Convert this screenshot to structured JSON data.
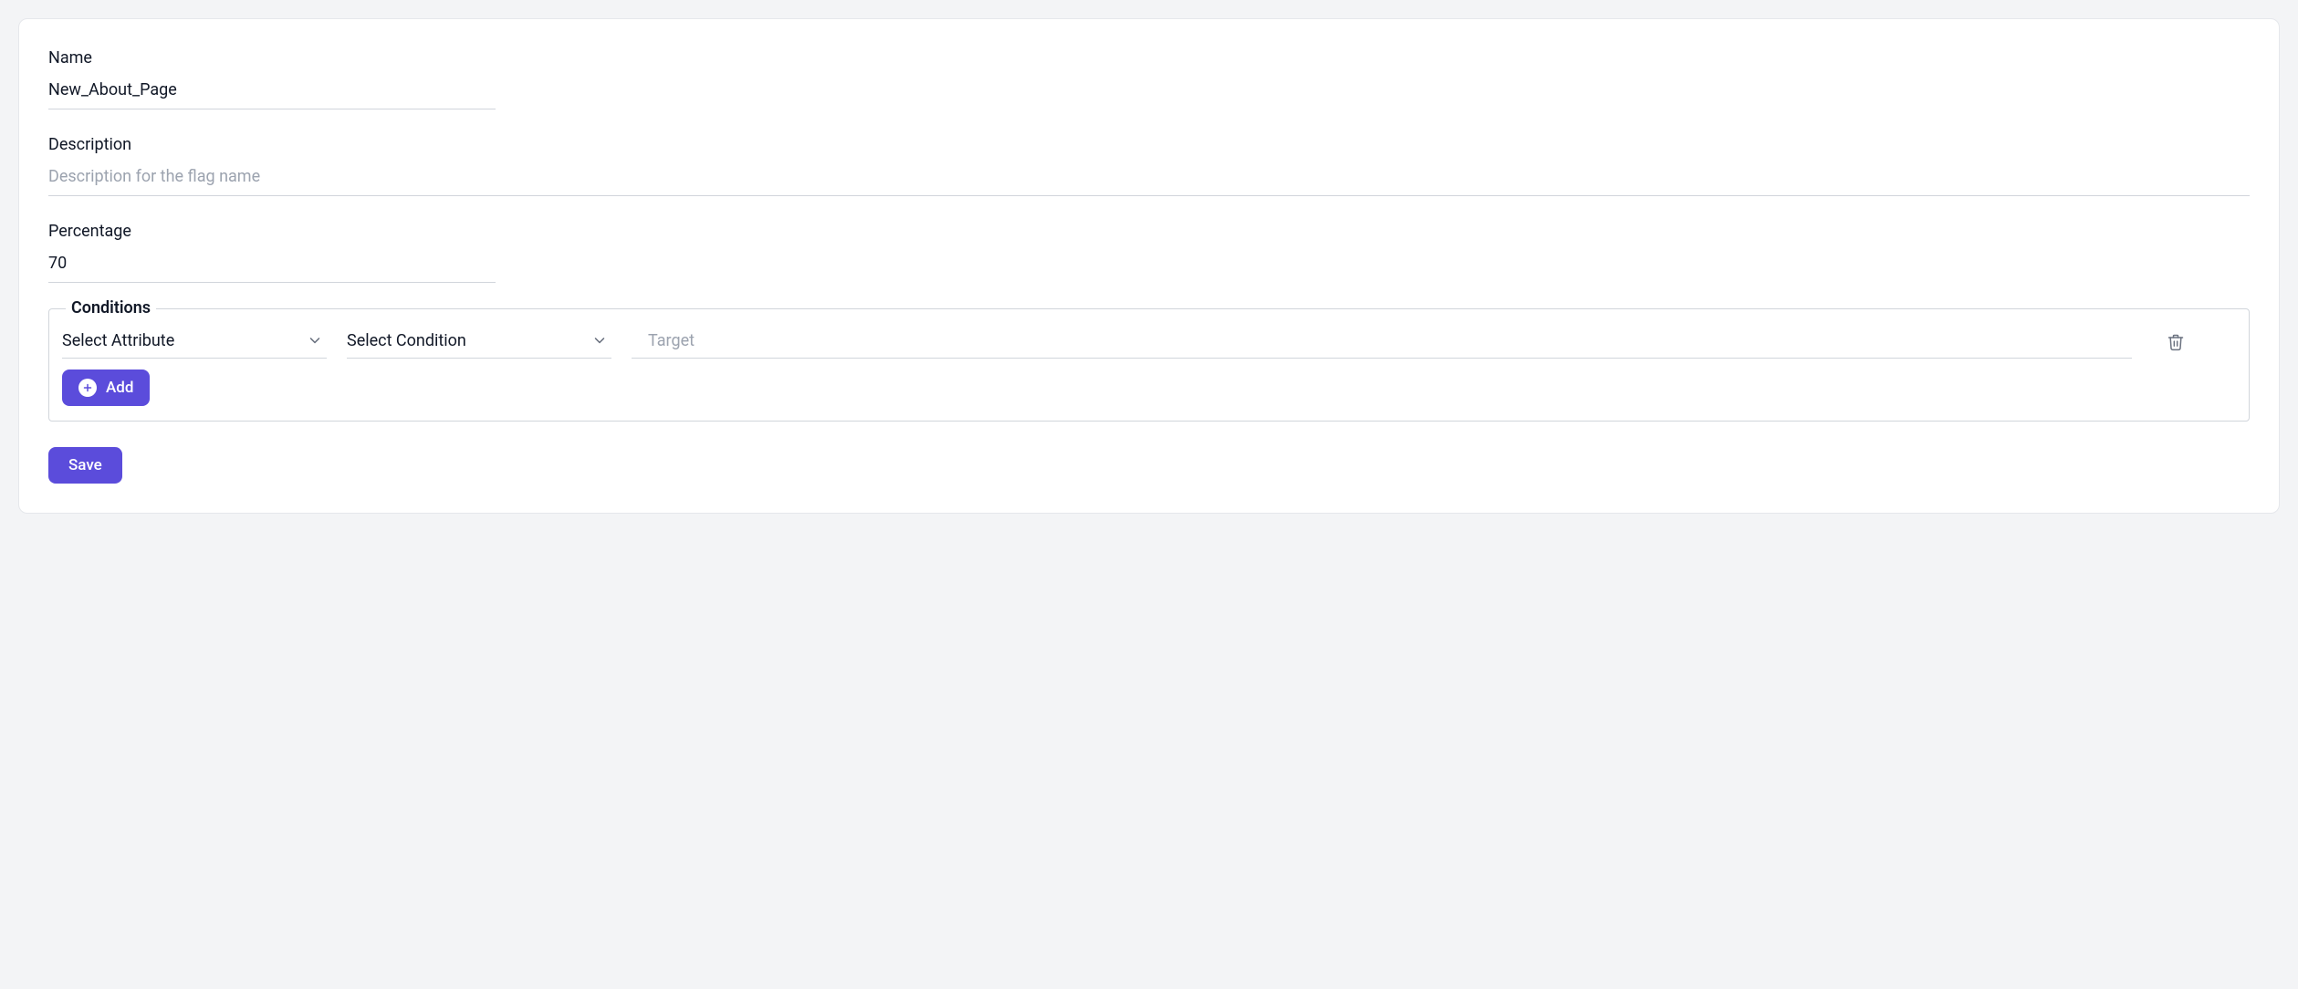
{
  "labels": {
    "name": "Name",
    "description": "Description",
    "percentage": "Percentage",
    "conditions": "Conditions"
  },
  "fields": {
    "name_value": "New_About_Page",
    "description_value": "",
    "description_placeholder": "Description for the flag name",
    "percentage_value": "70"
  },
  "conditions": {
    "attribute_select": "Select Attribute",
    "condition_select": "Select Condition",
    "target_value": "",
    "target_placeholder": "Target"
  },
  "buttons": {
    "add": "Add",
    "save": "Save"
  }
}
